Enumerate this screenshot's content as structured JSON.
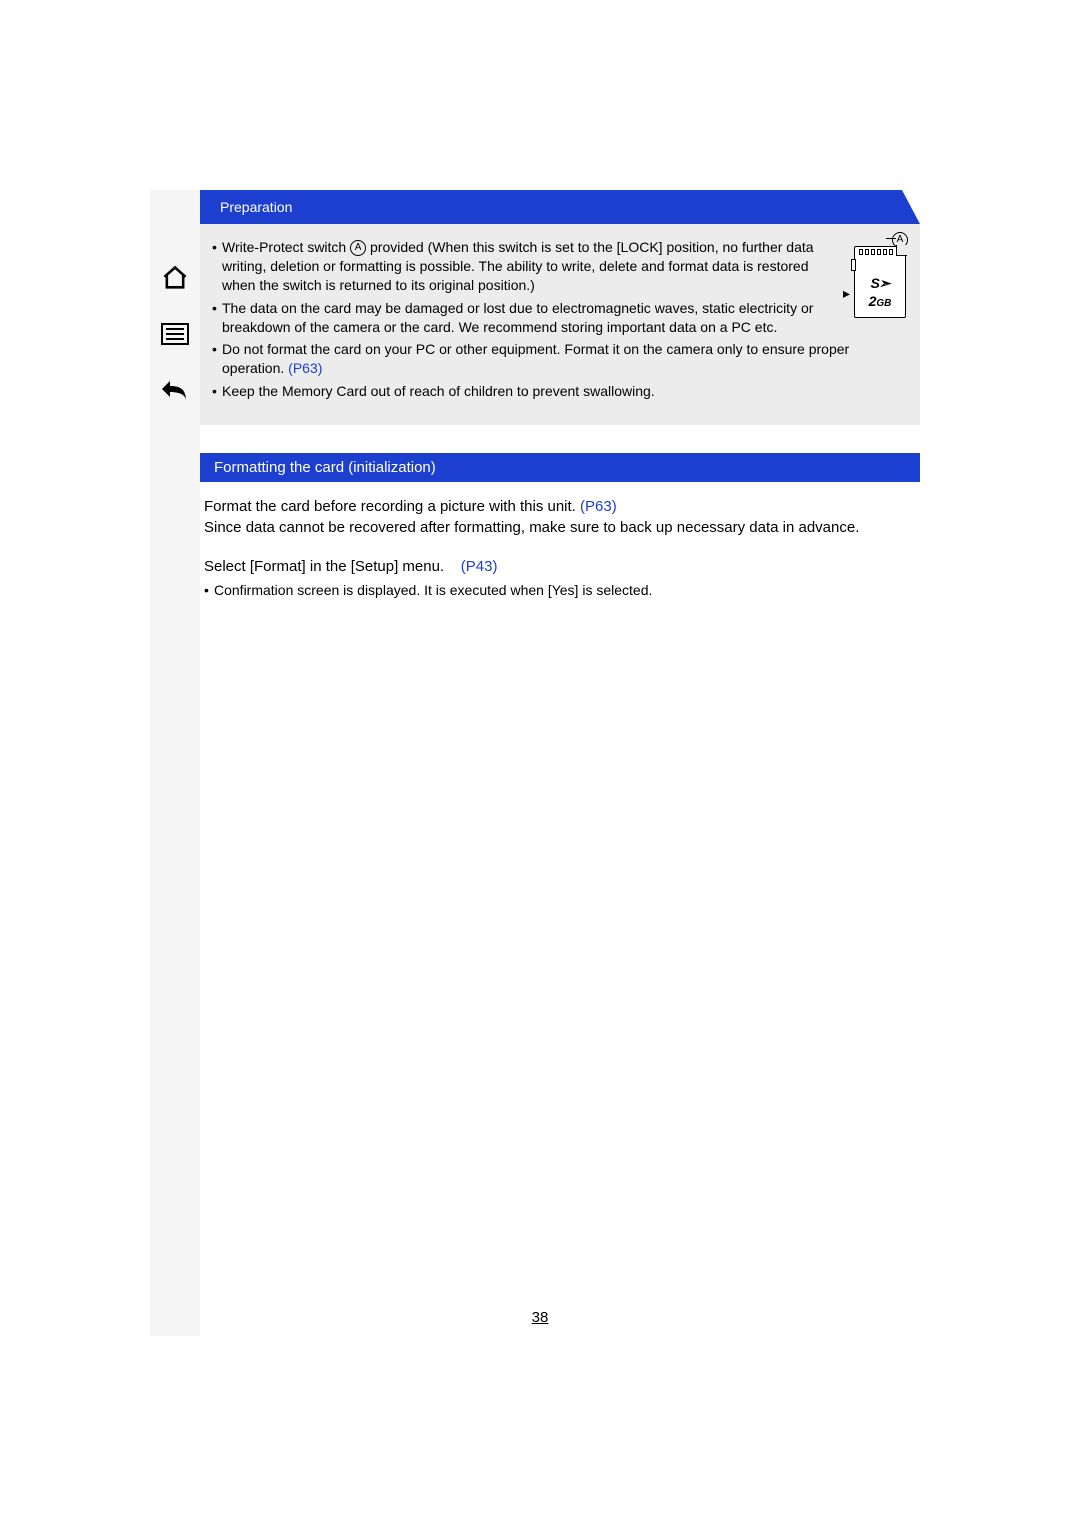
{
  "header": {
    "breadcrumb": "Preparation"
  },
  "sidebar": {
    "home_icon": "home-icon",
    "menu_icon": "menu-icon",
    "back_icon": "back-icon"
  },
  "notes": {
    "bullet1_a": "Write-Protect switch ",
    "bullet1_marker": "A",
    "bullet1_b": " provided (When this switch is set to the [LOCK] position, no further data writing, deletion or formatting is possible. The ability to write, delete and format data is restored when the switch is returned to its original position.)",
    "bullet2": "The data on the card may be damaged or lost due to electromagnetic waves, static electricity or breakdown of the camera or the card. We recommend storing important data on a PC etc.",
    "bullet3_a": "Do not format the card on your PC or other equipment. Format it on the camera only to ensure proper operation. ",
    "bullet3_link": "(P63)",
    "bullet4": "Keep the Memory Card out of reach of children to prevent swallowing."
  },
  "figure": {
    "label": "A",
    "logo": "S➣",
    "capacity_num": "2",
    "capacity_unit": "GB"
  },
  "section": {
    "title": "Formatting the card (initialization)",
    "para1_a": "Format the card before recording a picture with this unit. ",
    "para1_link": "(P63)",
    "para1_b": "Since data cannot be recovered after formatting, make sure to back up necessary data in advance.",
    "para2_a": "Select [Format] in the [Setup] menu.",
    "para2_link": "(P43)",
    "sub_bullet": "Confirmation screen is displayed. It is executed when [Yes] is selected."
  },
  "page_number": "38"
}
